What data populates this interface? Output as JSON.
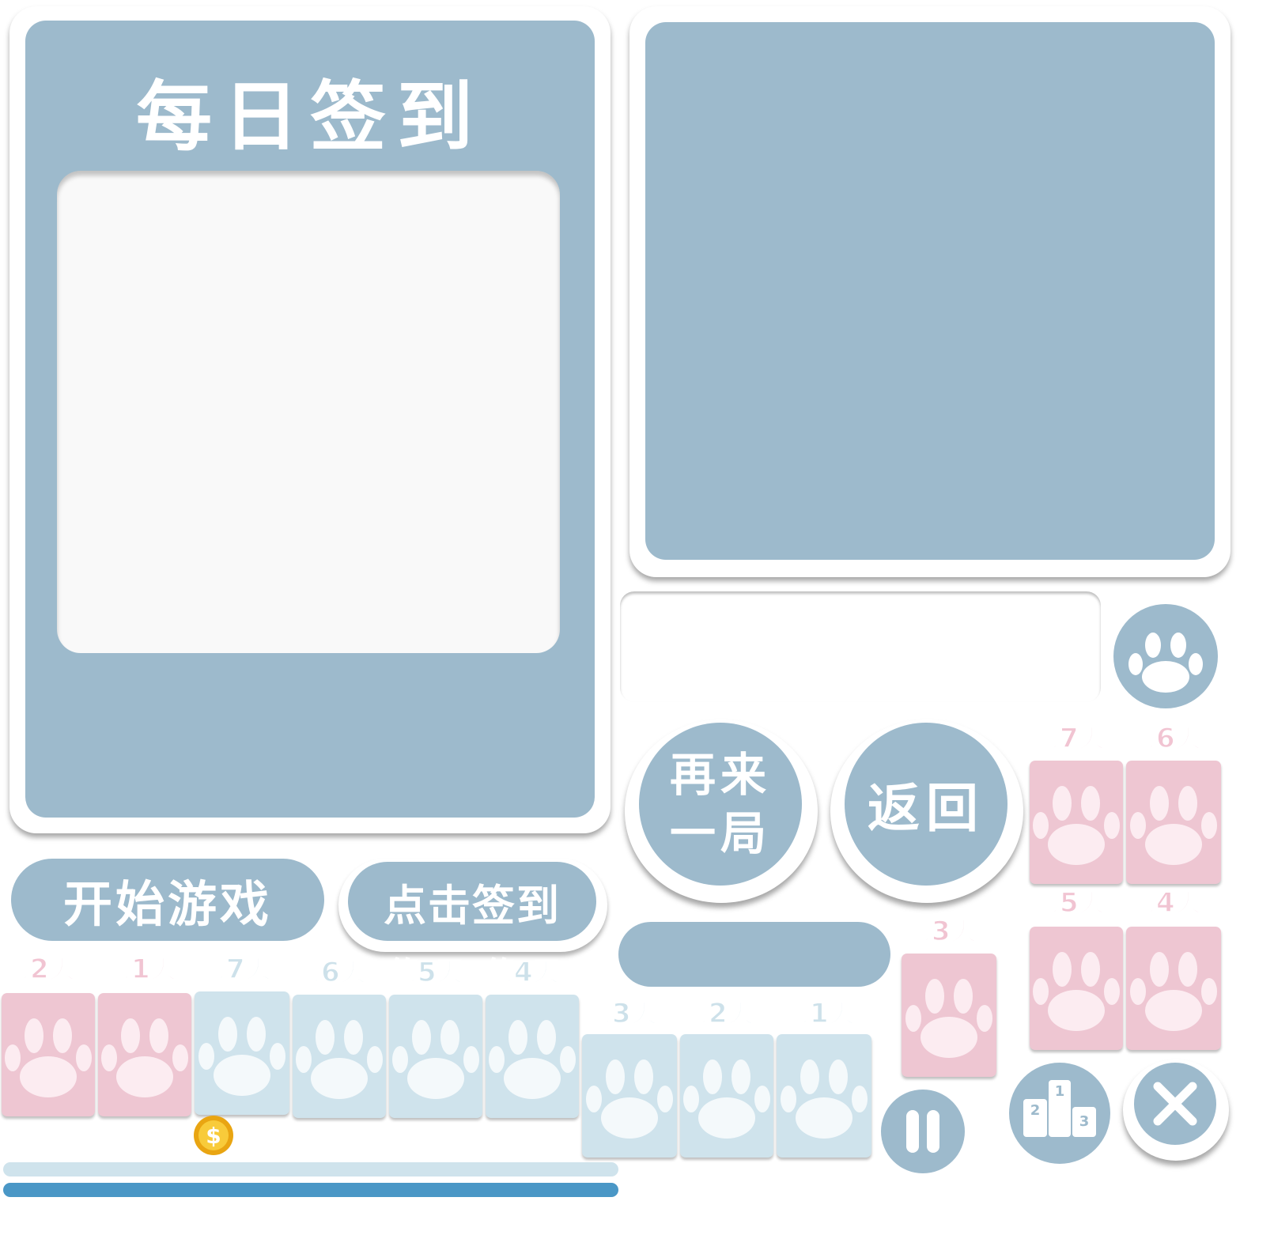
{
  "colors": {
    "panel": "#9dbacc",
    "pink_tile": "#eec6d2",
    "blue_tile": "#cfe3ec",
    "paw_pink": "#fcecf1",
    "paw_blue": "#f4f9fb",
    "bar_light": "#cfe3ec",
    "bar_dark": "#4a97c6",
    "coin": "#f6c42b"
  },
  "signin_panel": {
    "title": "每日签到"
  },
  "buttons": {
    "start_game": "开始游戏",
    "click_signin": "点击签到",
    "play_again_line1": "再来",
    "play_again_line2": "一局",
    "back": "返回"
  },
  "days": {
    "day1": "第1天",
    "day2": "第2天",
    "day3": "第3天",
    "day4": "第4天",
    "day5": "第5天",
    "day6": "第6天",
    "day7": "第7天"
  },
  "icons": {
    "paw": "paw-icon",
    "pause": "pause-icon",
    "rank": "podium-icon",
    "close": "close-icon",
    "coin": "coin-icon"
  },
  "podium": {
    "first": "1",
    "second": "2",
    "third": "3"
  },
  "coin_symbol": "$"
}
